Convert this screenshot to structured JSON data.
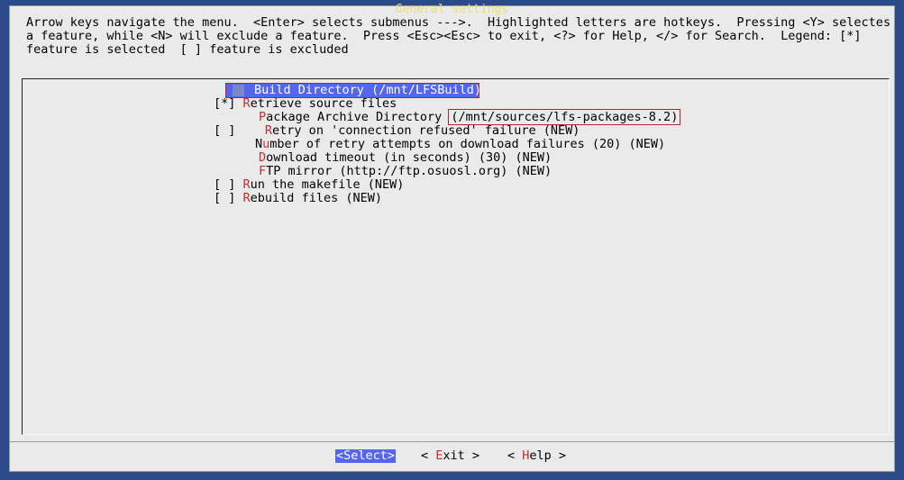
{
  "window": {
    "title": "General settings"
  },
  "help_lines": [
    "Arrow keys navigate the menu.  <Enter> selects submenus --->.  Highlighted letters are hotkeys.  Pressing <Y> selectes",
    "a feature, while <N> will exclude a feature.  Press <Esc><Esc> to exit, <?> for Help, </> for Search.  Legend: [*]",
    "feature is selected  [ ] feature is excluded"
  ],
  "menu": {
    "selected": {
      "label": "Build Directory",
      "value": "(/mnt/LFSBuild)"
    },
    "retrieve": {
      "prefix": "[*]",
      "hotkey": "R",
      "rest": "etrieve source files"
    },
    "package_archive": {
      "hotkey": "P",
      "rest": "ackage Archive Directory",
      "value": "(/mnt/sources/lfs-packages-8.2)"
    },
    "retry_refused": {
      "prefix": "[ ]",
      "hotkey": "R",
      "rest": "etry on 'connection refused' failure (NEW)"
    },
    "retry_attempts": {
      "pre": "N",
      "hotkey": "u",
      "rest": "mber of retry attempts on download failures (20) (NEW)"
    },
    "download_timeout": {
      "hotkey": "D",
      "rest": "ownload timeout (in seconds) (30) (NEW)"
    },
    "ftp_mirror": {
      "hotkey": "F",
      "rest": "TP mirror (http://ftp.osuosl.org) (NEW)"
    },
    "run_makefile": {
      "prefix": "[ ]",
      "hotkey": "R",
      "rest": "un the makefile (NEW)"
    },
    "rebuild": {
      "prefix": "[ ]",
      "hotkey": "R",
      "rest": "ebuild files (NEW)"
    }
  },
  "buttons": {
    "select": "<Select>",
    "exit_open": "< ",
    "exit_hotkey": "E",
    "exit_rest": "xit >",
    "help_open": "< ",
    "help_hotkey": "H",
    "help_rest": "elp >"
  }
}
